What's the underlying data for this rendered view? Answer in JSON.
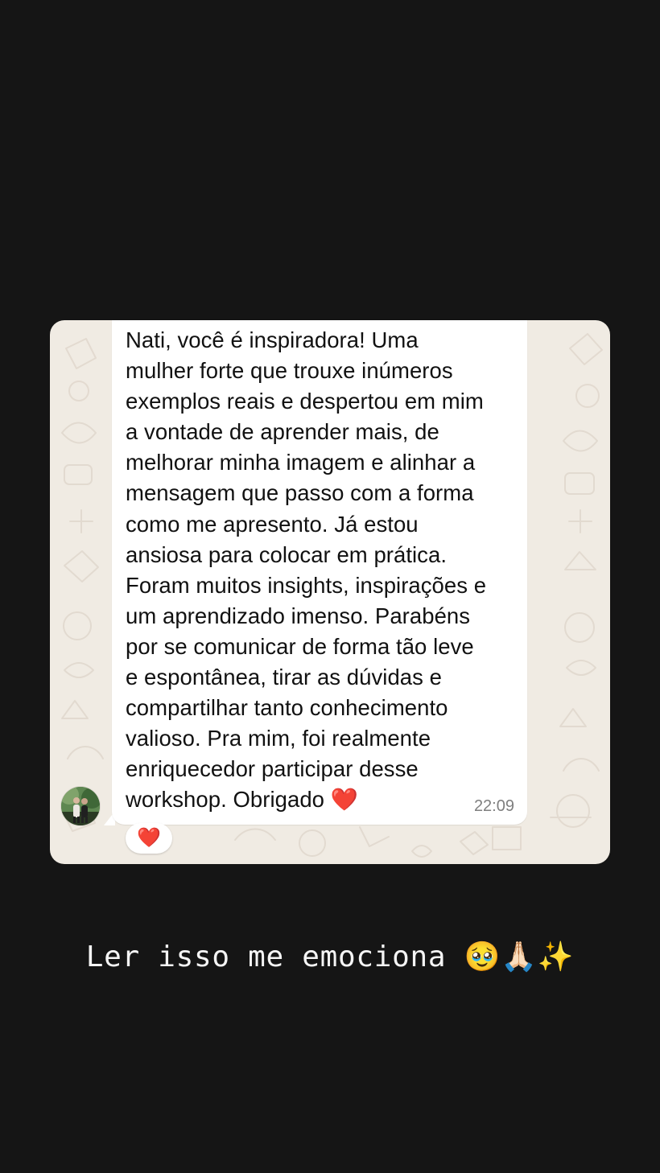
{
  "message": {
    "text": "Nati, você é inspiradora! Uma\nmulher forte que trouxe inúmeros\nexemplos reais e despertou em mim\na vontade de aprender mais, de\nmelhorar minha imagem e alinhar a\nmensagem que passo com a forma\ncomo me apresento. Já estou\nansiosa para colocar em prática.\nForam muitos insights, inspirações e\num aprendizado imenso. Parabéns\npor se comunicar de forma tão leve\ne espontânea, tirar as dúvidas e\ncompartilhar tanto conhecimento\nvalioso. Pra mim, foi realmente\nenriquecedor participar desse\nworkshop. Obrigado ❤️",
    "time": "22:09",
    "reaction": "❤️"
  },
  "caption": {
    "text": "Ler isso me emociona 🥹🙏🏻✨"
  },
  "icons": {
    "avatar": "profile-photo",
    "reaction": "heart-icon"
  },
  "colors": {
    "background": "#151515",
    "chat_wallpaper": "#f0ebe3",
    "bubble": "#ffffff",
    "text": "#111111",
    "timestamp": "#7f7f7f"
  }
}
